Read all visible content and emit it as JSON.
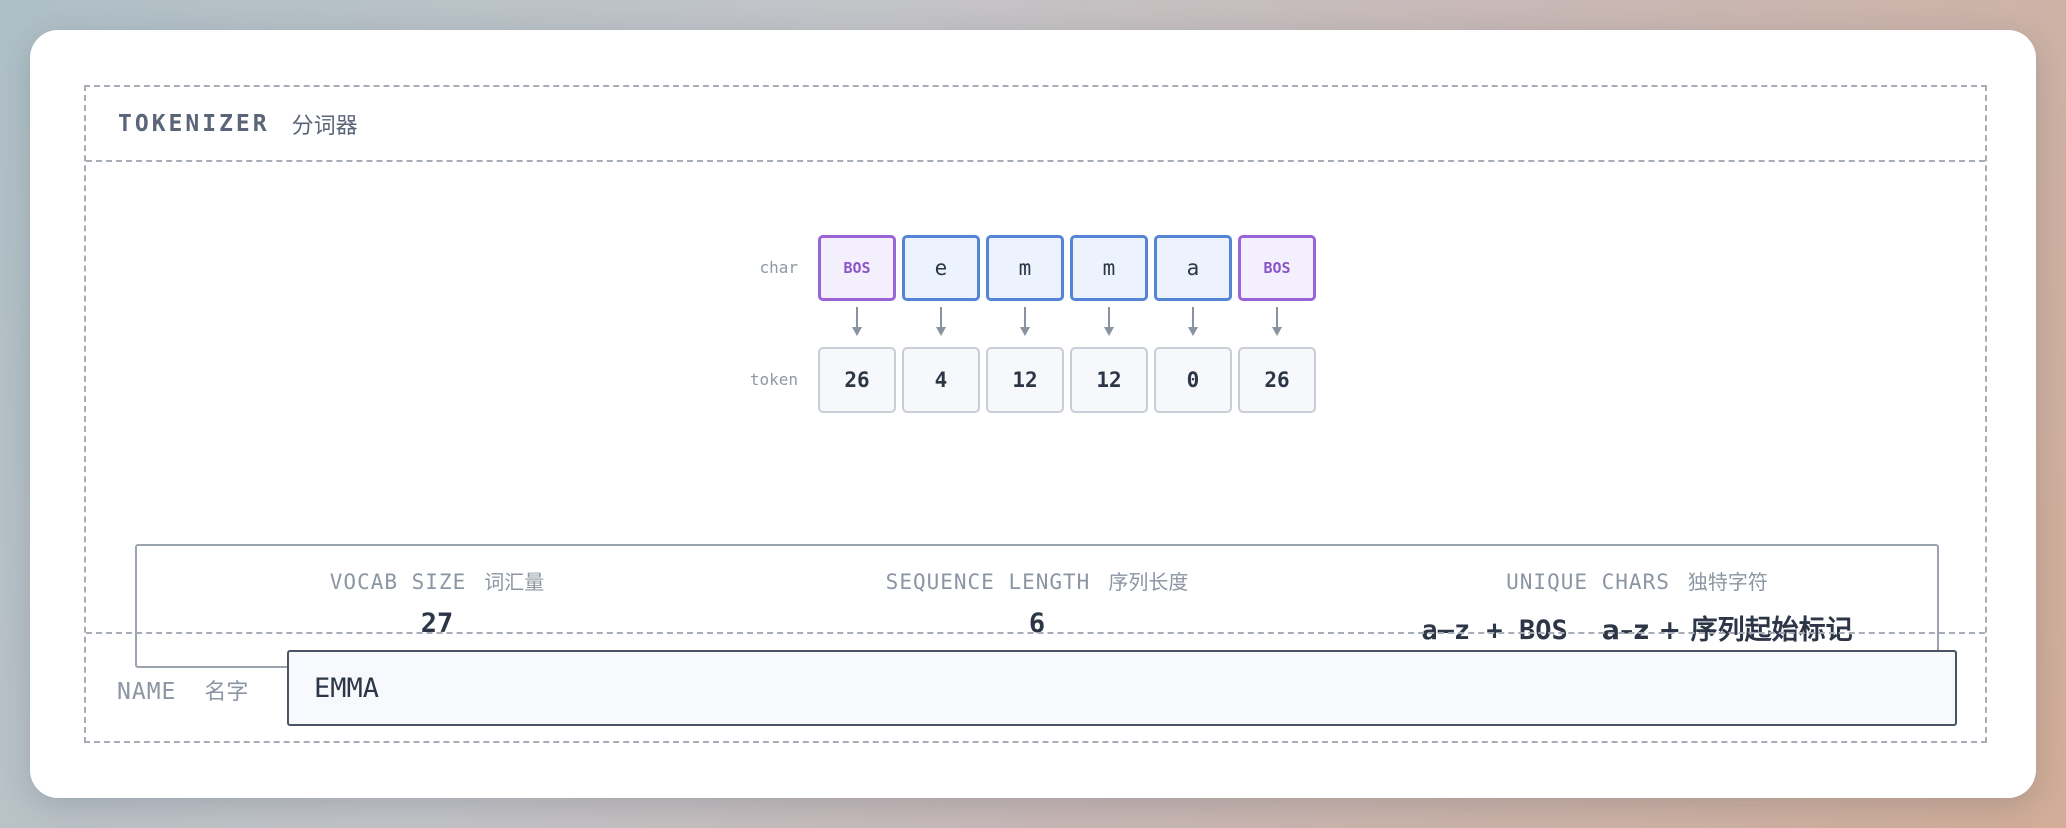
{
  "header": {
    "title_en": "TOKENIZER",
    "title_zh": "分词器"
  },
  "rows": {
    "char_label": "char",
    "token_label": "token"
  },
  "chars": [
    {
      "text": "BOS",
      "bos": true
    },
    {
      "text": "e",
      "bos": false
    },
    {
      "text": "m",
      "bos": false
    },
    {
      "text": "m",
      "bos": false
    },
    {
      "text": "a",
      "bos": false
    },
    {
      "text": "BOS",
      "bos": true
    }
  ],
  "tokens": [
    "26",
    "4",
    "12",
    "12",
    "0",
    "26"
  ],
  "stats": {
    "vocab": {
      "label_en": "VOCAB SIZE",
      "label_zh": "词汇量",
      "value": "27"
    },
    "seq": {
      "label_en": "SEQUENCE LENGTH",
      "label_zh": "序列长度",
      "value": "6"
    },
    "unique": {
      "label_en": "UNIQUE CHARS",
      "label_zh": "独特字符",
      "value_en": "a–z + BOS",
      "value_zh": "a–z + 序列起始标记"
    }
  },
  "name": {
    "label_en": "NAME",
    "label_zh": "名字",
    "value": "EMMA"
  },
  "colors": {
    "char_border": "#5583d6",
    "bos_border": "#9b63d8",
    "token_border": "#c9ced6",
    "arrow": "#8a93a1"
  }
}
